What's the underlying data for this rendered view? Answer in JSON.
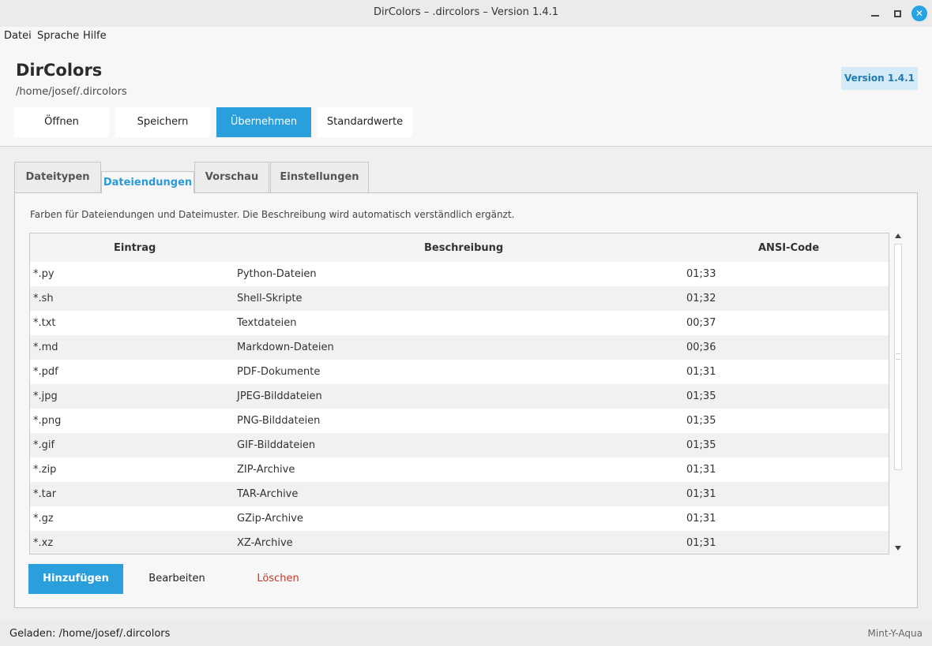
{
  "window": {
    "title": "DirColors – .dircolors – Version 1.4.1",
    "close_glyph": "✕"
  },
  "menu": [
    "Datei",
    "Sprache",
    "Hilfe"
  ],
  "header": {
    "app_title": "DirColors",
    "file_path": "/home/josef/.dircolors",
    "version_badge": "Version 1.4.1"
  },
  "toolbar": {
    "open_label": "Öffnen",
    "save_label": "Speichern",
    "apply_label": "Übernehmen",
    "defaults_label": "Standardwerte"
  },
  "tabs": [
    {
      "label": "Dateitypen",
      "active": false
    },
    {
      "label": "Dateiendungen",
      "active": true
    },
    {
      "label": "Vorschau",
      "active": false
    },
    {
      "label": "Einstellungen",
      "active": false
    }
  ],
  "panel": {
    "hint": "Farben für Dateiendungen und Dateimuster. Die Beschreibung wird automatisch verständlich ergänzt."
  },
  "table": {
    "columns": [
      "Eintrag",
      "Beschreibung",
      "ANSI-Code"
    ],
    "rows": [
      [
        "*.py",
        "Python-Dateien",
        "01;33"
      ],
      [
        "*.sh",
        "Shell-Skripte",
        "01;32"
      ],
      [
        "*.txt",
        "Textdateien",
        "00;37"
      ],
      [
        "*.md",
        "Markdown-Dateien",
        "00;36"
      ],
      [
        "*.pdf",
        "PDF-Dokumente",
        "01;31"
      ],
      [
        "*.jpg",
        "JPEG-Bilddateien",
        "01;35"
      ],
      [
        "*.png",
        "PNG-Bilddateien",
        "01;35"
      ],
      [
        "*.gif",
        "GIF-Bilddateien",
        "01;35"
      ],
      [
        "*.zip",
        "ZIP-Archive",
        "01;31"
      ],
      [
        "*.tar",
        "TAR-Archive",
        "01;31"
      ],
      [
        "*.gz",
        "GZip-Archive",
        "01;31"
      ],
      [
        "*.xz",
        "XZ-Archive",
        "01;31"
      ]
    ]
  },
  "actions": {
    "add_label": "Hinzufügen",
    "edit_label": "Bearbeiten",
    "delete_label": "Löschen"
  },
  "status": {
    "loaded": "Geladen: /home/josef/.dircolors",
    "theme": "Mint-Y-Aqua"
  },
  "colors": {
    "accent": "#2b9fdc",
    "danger": "#c0392b",
    "badge_bg": "#d4eaf7"
  }
}
